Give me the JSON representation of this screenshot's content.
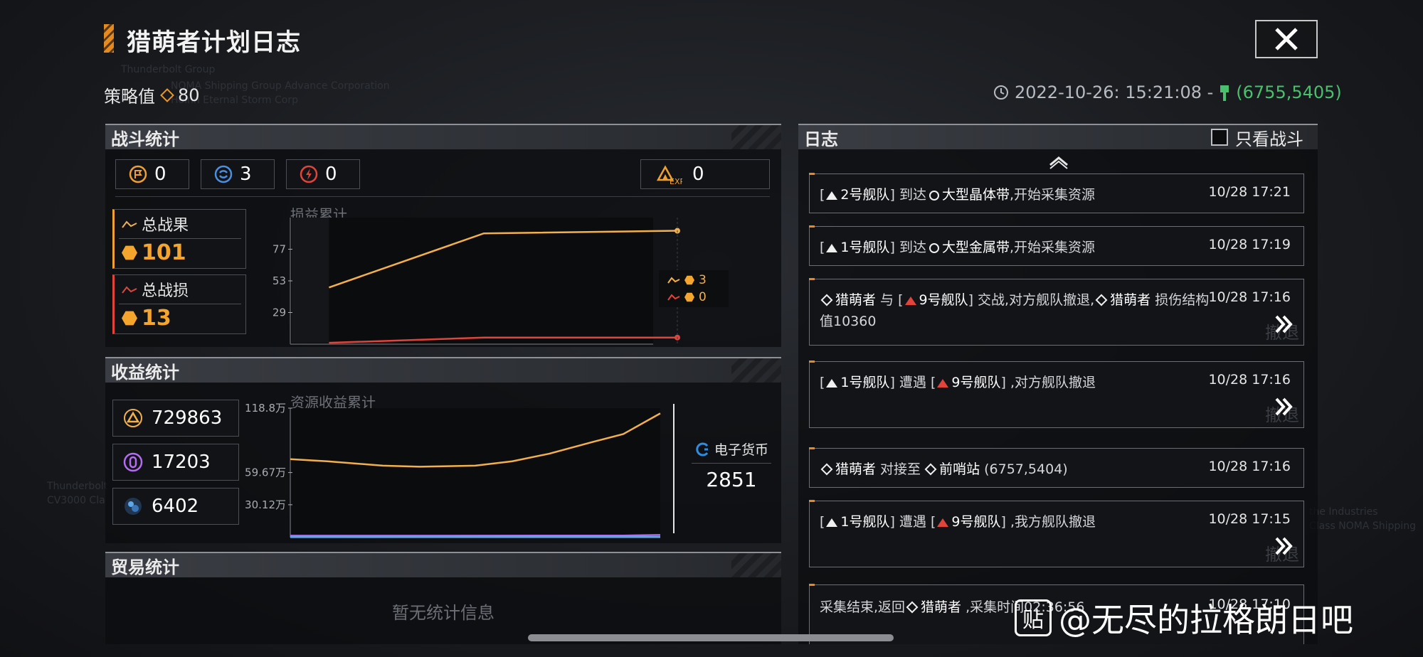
{
  "header": {
    "title": "猎萌者计划日志",
    "close_label": "✕"
  },
  "strategy": {
    "label": "策略值",
    "value": "80"
  },
  "timestamp": {
    "time": "2022-10-26: 15:21:08 -",
    "coord": "(6755,5405)"
  },
  "battle": {
    "section_title": "战斗统计",
    "counts": [
      {
        "icon": "flag-icon",
        "value": "0",
        "color": "#f0a030"
      },
      {
        "icon": "cycle-icon",
        "value": "3",
        "color": "#4a8fe0"
      },
      {
        "icon": "bolt-icon",
        "value": "0",
        "color": "#e0443a"
      }
    ],
    "exp": {
      "label": "EXP",
      "value": "0"
    },
    "total_gain": {
      "label": "总战果",
      "value": "101"
    },
    "total_loss": {
      "label": "总战损",
      "value": "13"
    },
    "chart_data": {
      "type": "line",
      "title": "损益累计",
      "yticks": [
        "77",
        "53",
        "29"
      ],
      "ylim": [
        5,
        101
      ],
      "series": [
        {
          "color": "#f3b04a",
          "values": [
            [
              0.1,
              48
            ],
            [
              0.5,
              89
            ],
            [
              1.0,
              91
            ]
          ]
        },
        {
          "color": "#e0443a",
          "values": [
            [
              0.1,
              6
            ],
            [
              0.5,
              10
            ],
            [
              1.0,
              10
            ]
          ]
        }
      ],
      "legend_values": [
        "3",
        "0"
      ]
    }
  },
  "income": {
    "section_title": "收益统计",
    "resources": [
      {
        "icon": "triangle-resource-icon",
        "value": "729863",
        "color": "#f3b04a"
      },
      {
        "icon": "crystal-resource-icon",
        "value": "17203",
        "color": "#b46cf0"
      },
      {
        "icon": "orb-resource-icon",
        "value": "6402",
        "color": "#5fa8e8"
      }
    ],
    "chart_data": {
      "type": "line",
      "title": "资源收益累计",
      "yticks": [
        "118.8万",
        "59.67万",
        "30.12万"
      ],
      "ylim": [
        0,
        118.8
      ],
      "series": [
        {
          "color": "#f3b04a",
          "values": [
            [
              0.0,
              72
            ],
            [
              0.1,
              70
            ],
            [
              0.25,
              66
            ],
            [
              0.35,
              65
            ],
            [
              0.5,
              66
            ],
            [
              0.6,
              70
            ],
            [
              0.7,
              77
            ],
            [
              0.82,
              88
            ],
            [
              0.9,
              95
            ],
            [
              1.0,
              114
            ]
          ]
        },
        {
          "color": "#b46cf0",
          "values": [
            [
              0.0,
              1.7
            ],
            [
              0.9,
              1.8
            ],
            [
              1.0,
              2.4
            ]
          ]
        },
        {
          "color": "#5fa8e8",
          "values": [
            [
              0.0,
              0.5
            ],
            [
              1.0,
              0.6
            ]
          ]
        }
      ]
    },
    "currency": {
      "label": "电子货币",
      "value": "2851"
    }
  },
  "trade": {
    "section_title": "贸易统计",
    "empty_text": "暂无统计信息"
  },
  "log": {
    "title": "日志",
    "filter_label": "只看战斗",
    "entries": [
      {
        "time": "10/28 17:21",
        "parts": [
          "[",
          "2号舰队",
          "] 到达",
          "大型晶体带",
          ",开始采集资源"
        ]
      },
      {
        "time": "10/28 17:19",
        "parts": [
          "[",
          "1号舰队",
          "] 到达",
          "大型金属带",
          ",开始采集资源"
        ]
      },
      {
        "time": "10/28 17:16",
        "parts": [
          "猎萌者",
          " 与 [",
          "9号舰队",
          "] 交战,对方舰队撤退,",
          "猎萌者",
          " 损伤结构值10360"
        ]
      },
      {
        "time": "10/28 17:16",
        "parts": [
          "[",
          "1号舰队",
          "] 遭遇 [",
          "9号舰队",
          "] ,对方舰队撤退"
        ]
      },
      {
        "time": "10/28 17:16",
        "parts": [
          "猎萌者",
          " 对接至",
          "前哨站",
          " (6757,5404)"
        ]
      },
      {
        "time": "10/28 17:15",
        "parts": [
          "[",
          "1号舰队",
          "] 遭遇 [",
          "9号舰队",
          "] ,我方舰队撤退"
        ]
      },
      {
        "time": "10/28 17:10",
        "parts": [
          "采集结束,返回",
          "猎萌者",
          " ,采集",
          "时间02:36:56"
        ]
      }
    ],
    "ghost_label": "撤退"
  },
  "watermark": {
    "badge": "贴",
    "text": "@无尽的拉格朗日吧"
  },
  "background_text": [
    "Thunderbolt Group",
    "NOMA Shipping Group Advance Corporation",
    "Hoinn Eternal Storm Corp",
    "Thunderbolt",
    "CV3000 Cla",
    "the Industries",
    "Class NOMA Shipping"
  ]
}
